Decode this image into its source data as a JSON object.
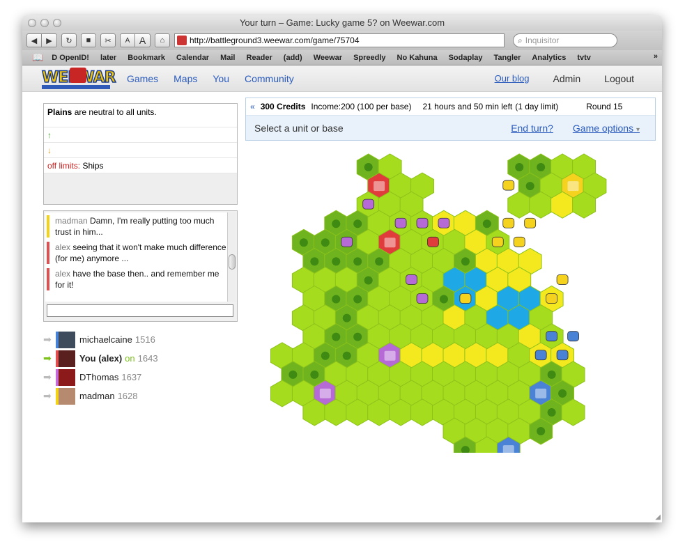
{
  "window": {
    "title": "Your turn – Game: Lucky game 5? on Weewar.com"
  },
  "toolbar": {
    "url": "http://battleground3.weewar.com/game/75704",
    "search_placeholder": "Inquisitor"
  },
  "bookmarks": [
    "D OpenID!",
    "later",
    "Bookmark",
    "Calendar",
    "Mail",
    "Reader",
    "(add)",
    "Weewar",
    "Spreedly",
    "No Kahuna",
    "Sodaplay",
    "Tangler",
    "Analytics",
    "tvtv"
  ],
  "site": {
    "logo_text": "WEEWAR",
    "nav": [
      "Games",
      "Maps",
      "You",
      "Community"
    ],
    "right": {
      "blog": "Our blog",
      "admin": "Admin",
      "logout": "Logout"
    }
  },
  "terrain": {
    "name": "Plains",
    "description": " are neutral to all units.",
    "up": "↑",
    "down": "↓",
    "off_label": "off limits:",
    "off_value": " Ships"
  },
  "chat": [
    {
      "who": "madman",
      "text": "Damn, I'm really putting too much trust in him...",
      "color": "yellow"
    },
    {
      "who": "alex",
      "text": "seeing that it won't make much difference (for me) anymore ...",
      "color": "red"
    },
    {
      "who": "alex",
      "text": "have the base then.. and remember me for it!",
      "color": "red"
    }
  ],
  "players": [
    {
      "name": "michaelcaine",
      "score": "1516",
      "active": false,
      "on": "",
      "avatar_color": "#3d4b5c",
      "side_color": "#4a82d6"
    },
    {
      "name": "You (alex)",
      "score": "1643",
      "active": true,
      "on": "on",
      "avatar_color": "#5a1f1f",
      "side_color": "#e05050"
    },
    {
      "name": "DThomas",
      "score": "1637",
      "active": false,
      "on": "",
      "avatar_color": "#8c1a1a",
      "side_color": "#c76bd6"
    },
    {
      "name": "madman",
      "score": "1628",
      "active": false,
      "on": "",
      "avatar_color": "#b58a6e",
      "side_color": "#f2d21a"
    }
  ],
  "game": {
    "back": "«",
    "credits": "300 Credits",
    "income": "Income:200 (100 per base)",
    "time_left": "21 hours and 50 min left",
    "limit": "(1 day limit)",
    "round": "Round 15",
    "prompt": "Select a unit or base",
    "end_turn": "End turn?",
    "options": "Game options",
    "options_caret": "▾"
  },
  "colors": {
    "plains": "#a6dc1e",
    "forest": "#6fb41e",
    "water": "#1ea8e6",
    "desert": "#f4e81e",
    "red": "#e03c3c",
    "purple": "#b56ad6",
    "yellow": "#f4d21e",
    "blue": "#4a82d6"
  }
}
